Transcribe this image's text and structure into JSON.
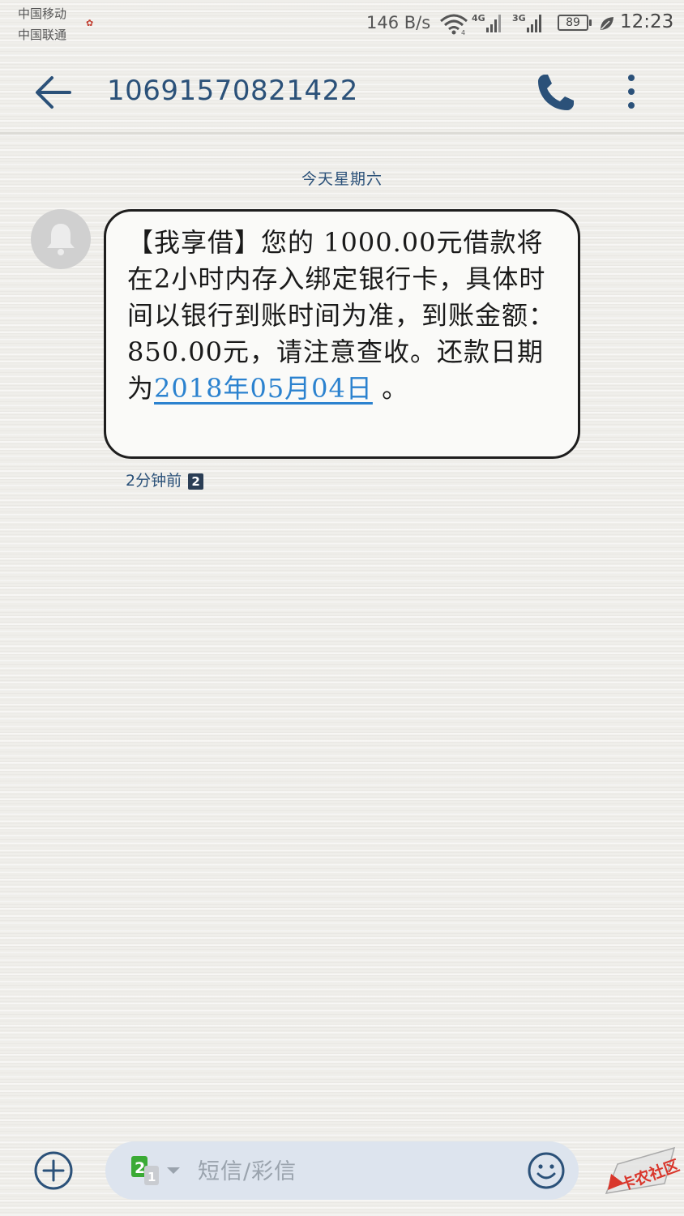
{
  "status_bar": {
    "carrier_1": "中国移动",
    "carrier_2": "中国联通",
    "network_speed": "146 B/s",
    "network_4g": "4G",
    "network_3g": "3G",
    "battery_level": "89",
    "time": "12:23",
    "icons": [
      "wifi-icon",
      "signal-4g-icon",
      "signal-3g-icon",
      "battery-icon",
      "leaf-icon"
    ]
  },
  "header": {
    "contact_number": "10691570821422",
    "icons": [
      "back-arrow-icon",
      "phone-icon",
      "more-vertical-icon"
    ]
  },
  "conversation": {
    "date_divider": "今天星期六",
    "message": {
      "text_before_link": "【我享借】您的 1000.00元借款将在2小时内存入绑定银行卡，具体时间以银行到账时间为准，到账金额：850.00元，请注意查收。还款日期为",
      "link_text": "2018年05月04日",
      "text_after_link": " 。",
      "time_ago": "2分钟前",
      "sim_slot": "2"
    }
  },
  "compose": {
    "placeholder": "短信/彩信",
    "sim_number_active": "2",
    "sim_number_inactive": "1",
    "icons": [
      "add-circle-icon",
      "sim-selector-icon",
      "emoji-icon"
    ]
  },
  "watermark": {
    "text": "卡农社区"
  },
  "colors": {
    "accent": "#2b5179",
    "link": "#2b82cf",
    "background": "#efeeea",
    "compose_bg": "#dde4ee",
    "sim_green": "#3aaa35"
  }
}
